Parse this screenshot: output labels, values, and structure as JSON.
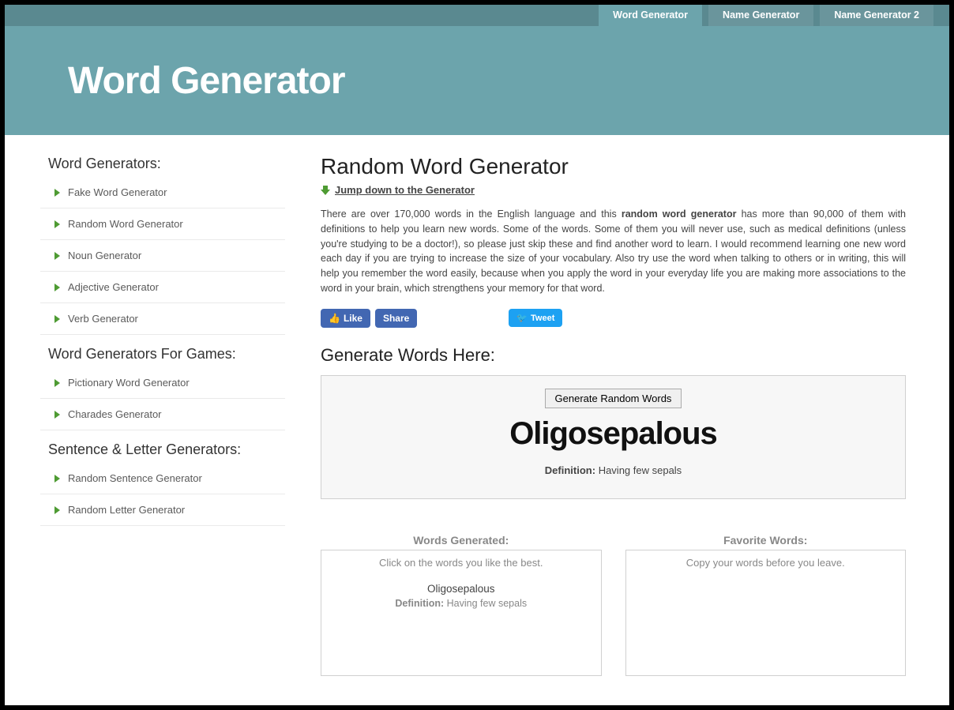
{
  "topNav": {
    "tabs": [
      {
        "label": "Word Generator",
        "active": true
      },
      {
        "label": "Name Generator",
        "active": false
      },
      {
        "label": "Name Generator 2",
        "active": false
      }
    ]
  },
  "hero": {
    "title": "Word Generator"
  },
  "sidebar": {
    "sections": [
      {
        "title": "Word Generators:",
        "items": [
          "Fake Word Generator",
          "Random Word Generator",
          "Noun Generator",
          "Adjective Generator",
          "Verb Generator"
        ]
      },
      {
        "title": "Word Generators For Games:",
        "items": [
          "Pictionary Word Generator",
          "Charades Generator"
        ]
      },
      {
        "title": "Sentence & Letter Generators:",
        "items": [
          "Random Sentence Generator",
          "Random Letter Generator"
        ]
      }
    ]
  },
  "main": {
    "title": "Random Word Generator",
    "jumpLink": "Jump down to the Generator",
    "descPre": "There are over 170,000 words in the English language and this ",
    "descBold": "random word generator",
    "descPost": " has more than 90,000 of them with definitions to help you learn new words. Some of the words. Some of them you will never use, such as medical definitions (unless you're studying to be a doctor!), so please just skip these and find another word to learn. I would recommend learning one new word each day if you are trying to increase the size of your vocabulary. Also try use the word when talking to others or in writing, this will help you remember the word easily, because when you apply the word in your everyday life you are making more associations to the word in your brain, which strengthens your memory for that word.",
    "social": {
      "like": "Like",
      "share": "Share",
      "tweet": "Tweet"
    },
    "generateHeading": "Generate Words Here:",
    "generateBtn": "Generate Random Words",
    "currentWord": "Oligosepalous",
    "defLabel": "Definition:",
    "currentDef": "Having few sepals",
    "columns": {
      "leftTitle": "Words Generated:",
      "leftHelp": "Click on the words you like the best.",
      "leftWord": "Oligosepalous",
      "leftDef": "Having few sepals",
      "rightTitle": "Favorite Words:",
      "rightHelp": "Copy your words before you leave."
    }
  }
}
